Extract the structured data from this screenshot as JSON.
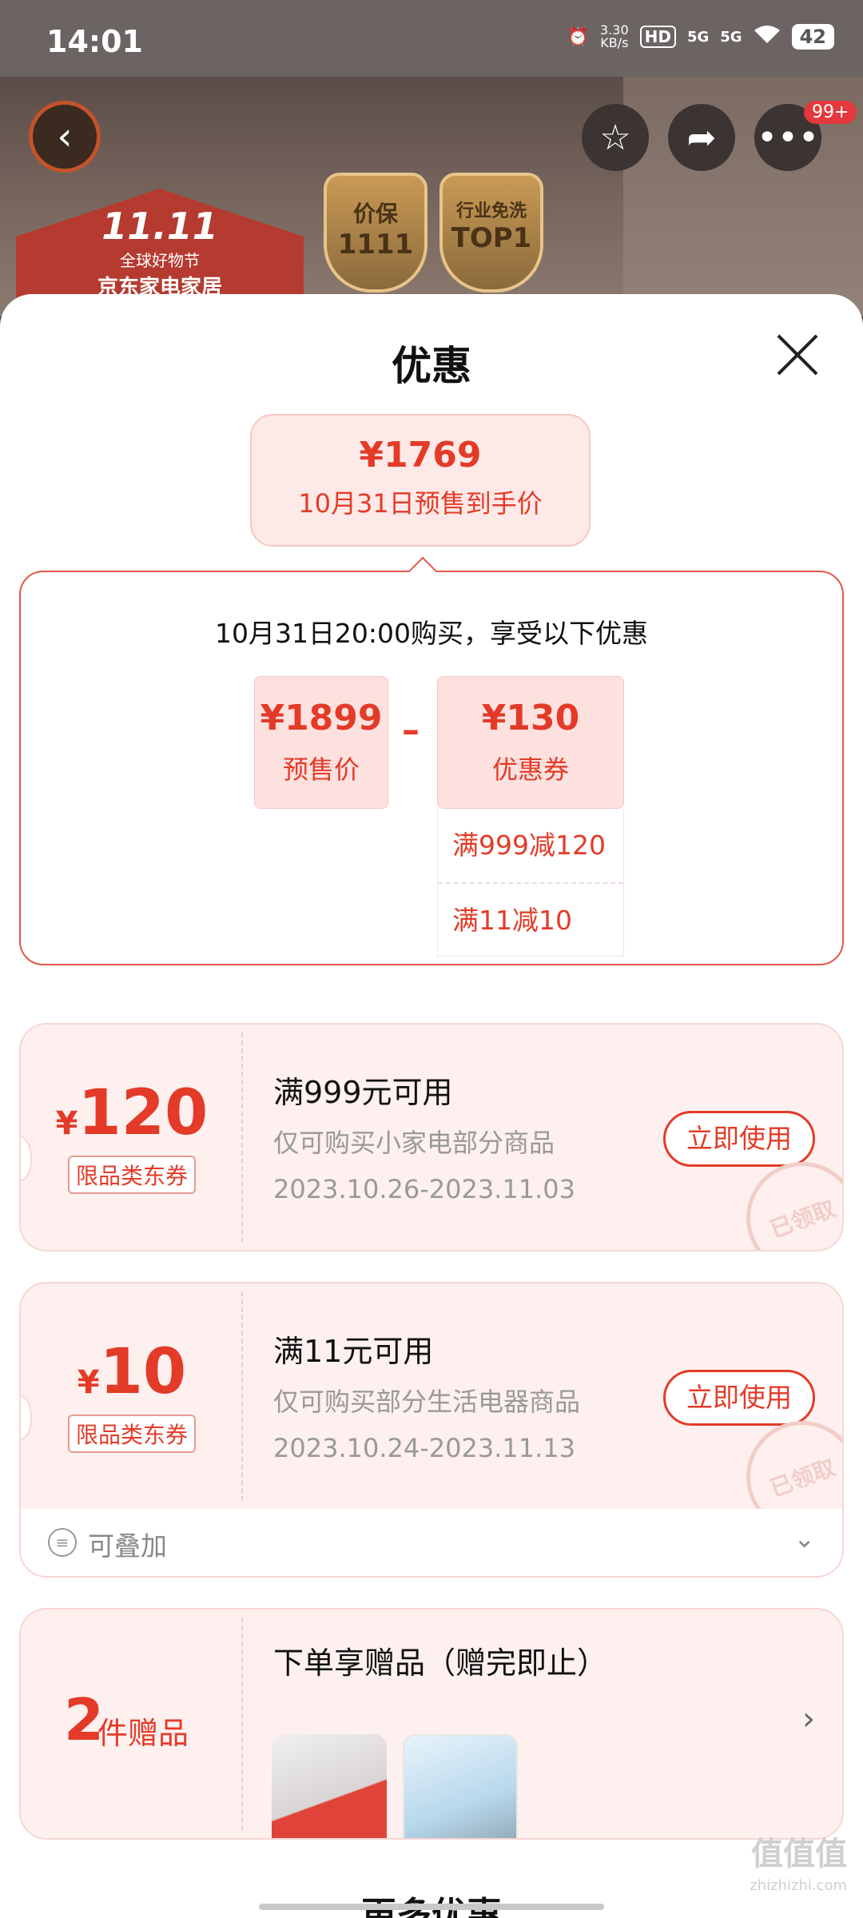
{
  "status_bar": {
    "time": "14:01",
    "net_speed": "3.30",
    "net_unit": "KB/s",
    "hd": "HD",
    "sig1": "5G",
    "sig2": "5G",
    "battery": "42"
  },
  "header": {
    "notification_badge": "99+",
    "promo": {
      "big": "11.11",
      "line1": "全球好物节",
      "line2": "京东家电家居",
      "shield1_top": "价保",
      "shield1_bottom": "1111",
      "shield2_top": "行业免洗",
      "shield2_bottom": "TOP1"
    }
  },
  "sheet": {
    "title": "优惠",
    "final_price": "¥1769",
    "final_price_desc": "10月31日预售到手价",
    "calc_header": "10月31日20:00购买，享受以下优惠",
    "presale_price": "¥1899",
    "presale_label": "预售价",
    "minus": "–",
    "coupon_total": "¥130",
    "coupon_total_label": "优惠券",
    "coupon_breakdown": [
      "满999减120",
      "满11减10"
    ]
  },
  "coupons": [
    {
      "yen": "¥",
      "amount": "120",
      "tag": "限品类东券",
      "condition": "满999元可用",
      "desc": "仅可购买小家电部分商品",
      "date": "2023.10.26-2023.11.03",
      "button": "立即使用",
      "stamp": "已领取"
    },
    {
      "yen": "¥",
      "amount": "10",
      "tag": "限品类东券",
      "condition": "满11元可用",
      "desc": "仅可购买部分生活电器商品",
      "date": "2023.10.24-2023.11.13",
      "button": "立即使用",
      "stamp": "已领取"
    }
  ],
  "stackable": {
    "label": "可叠加"
  },
  "gift": {
    "count": "2",
    "unit": "件赠品",
    "title": "下单享赠品（赠完即止）"
  },
  "more_section": "更多优惠",
  "watermark": {
    "text": "值值值",
    "url": "zhizhizhi.com"
  }
}
